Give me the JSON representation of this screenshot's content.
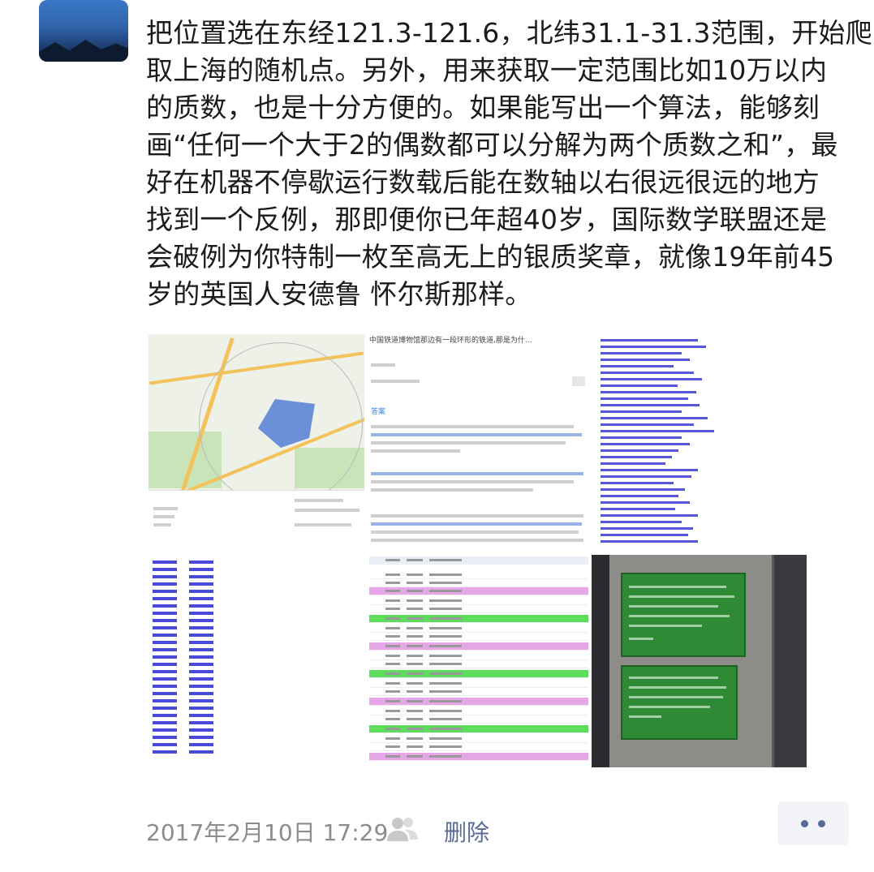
{
  "post": {
    "text_lines": [
      "把位置选在东经121.3-121.6，北纬31.1-31.3范围，开始爬",
      "取上海的随机点。另外，用来获取一定范围比如10万以内",
      "的质数，也是十分方便的。如果能写出一个算法，能够刻",
      "画“任何一个大于2的偶数都可以分解为两个质数之和”，最",
      "好在机器不停歇运行数载后能在数轴以右很远很远的地方",
      "找到一个反例，那即便你已年超40岁，国际数学联盟还是",
      "会破例为你特制一枚至高无上的银质奖章，就像19年前45",
      "岁的英国人安德鲁 怀尔斯那样。"
    ],
    "images": {
      "article_headline": "中国铁道博物馆那边有一段环形的铁道,那是为什...",
      "article_tag": "答案"
    }
  },
  "footer": {
    "timestamp": "2017年2月10日 17:29",
    "delete_label": "删除",
    "more_icon": "ellipsis-icon",
    "friends_icon": "friends-visibility-icon"
  },
  "colors": {
    "link": "#576b95",
    "timestamp": "#8c8c8c",
    "text": "#1b1b1b"
  }
}
